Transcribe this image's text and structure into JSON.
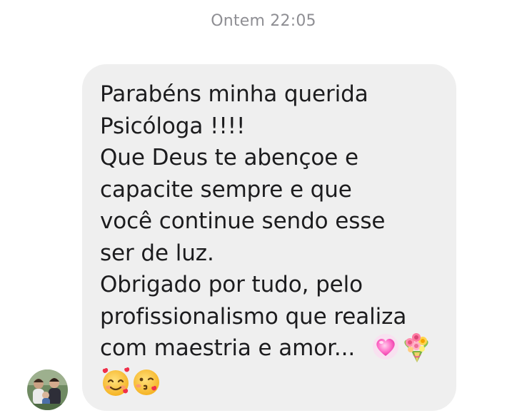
{
  "timestamp": "Ontem 22:05",
  "message": {
    "text": "Parabéns minha querida\nPsicóloga !!!!\nQue Deus te abençoe e\ncapacite sempre e que\nvocê continue sendo esse\nser de luz.\nObrigado por tudo, pelo\nprofissionalismo que realiza\ncom maestria e amor...",
    "emojis": [
      "heart-icon",
      "bouquet-icon",
      "smiling-face-with-hearts-icon",
      "face-blowing-kiss-icon"
    ]
  },
  "sender": {
    "avatar": "avatar"
  },
  "colors": {
    "bubble": "#efefef",
    "text": "#1c1c1e",
    "timestamp": "#8e8e93",
    "background": "#ffffff"
  }
}
